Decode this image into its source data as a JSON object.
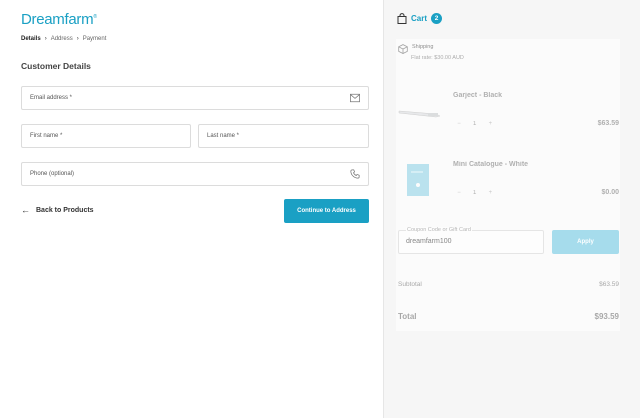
{
  "brand": {
    "logo_text": "Dreamfarm",
    "color": "#1aa0c4"
  },
  "breadcrumb": {
    "steps": [
      "Details",
      "Address",
      "Payment"
    ]
  },
  "form": {
    "title": "Customer Details",
    "email_label": "Email address *",
    "first_name_label": "First name *",
    "last_name_label": "Last name *",
    "phone_label": "Phone (optional)"
  },
  "actions": {
    "back_label": "Back to Products",
    "continue_label": "Continue to Address"
  },
  "cart": {
    "label": "Cart",
    "count": "2",
    "shipping": {
      "title": "Shipping",
      "rate": "Flat rate: $30.00 AUD"
    },
    "items": [
      {
        "name": "Garject - Black",
        "qty": "1",
        "price": "$63.59",
        "minus": "−",
        "plus": "+"
      },
      {
        "name": "Mini Catalogue - White",
        "qty": "1",
        "price": "$0.00",
        "minus": "−",
        "plus": "+"
      }
    ],
    "coupon": {
      "placeholder": "Coupon Code or Gift Card",
      "value": "dreamfarm100",
      "apply_label": "Apply"
    },
    "subtotal_label": "Subtotal",
    "subtotal_value": "$63.59",
    "total_label": "Total",
    "total_value": "$93.59"
  }
}
